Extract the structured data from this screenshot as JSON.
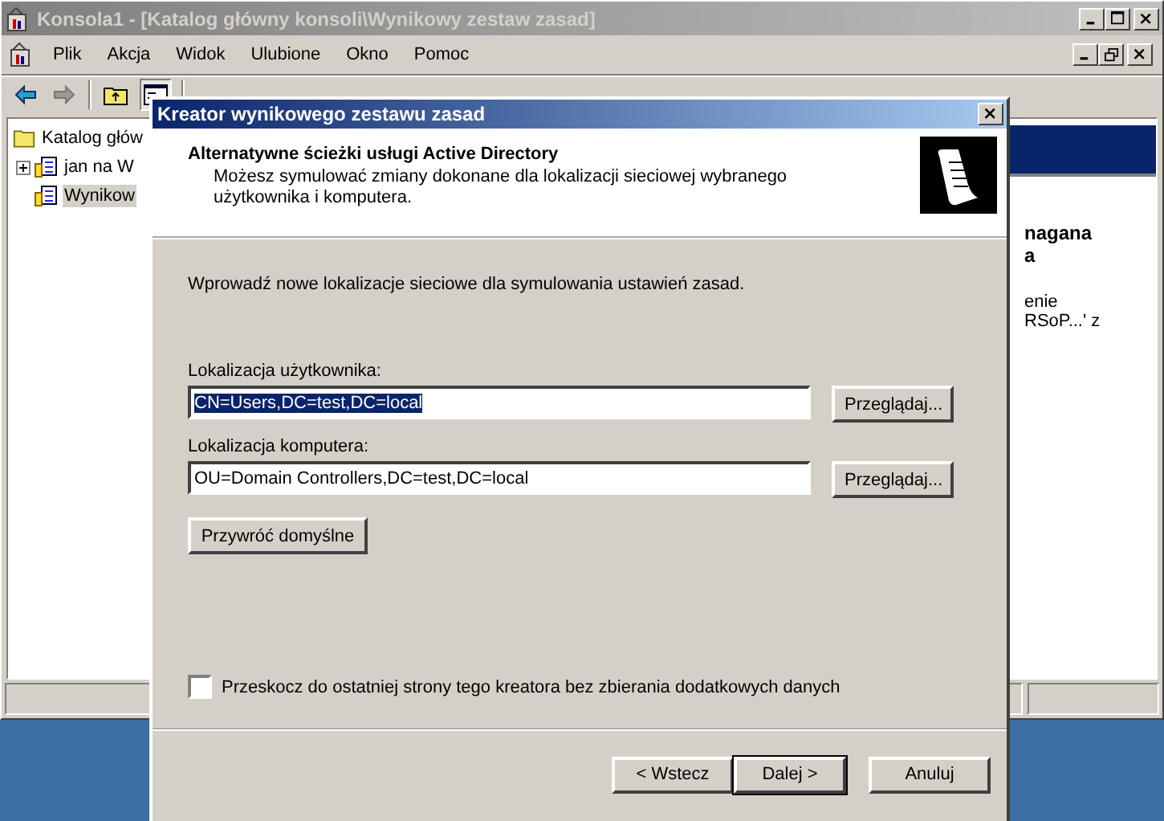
{
  "window": {
    "title": "Konsola1 - [Katalog główny konsoli\\Wynikowy zestaw zasad]",
    "active": false
  },
  "menu": [
    "Plik",
    "Akcja",
    "Widok",
    "Ulubione",
    "Okno",
    "Pomoc"
  ],
  "tree": [
    {
      "label": "Katalog głów",
      "selected": false,
      "children": [
        {
          "label": "jan na W",
          "selected": false,
          "expanded": false
        },
        {
          "label": "Wynikow",
          "selected": true
        }
      ]
    }
  ],
  "right_pane": {
    "lines": [
      {
        "text": "nagana",
        "bold": true
      },
      {
        "text": "a",
        "bold": true
      },
      {
        "text": "enie",
        "bold": false
      },
      {
        "text": "RSoP...' z",
        "bold": false
      }
    ]
  },
  "dialog": {
    "title": "Kreator wynikowego zestawu zasad",
    "active": true,
    "heading": "Alternatywne ścieżki usługi Active Directory",
    "subheading": "Możesz symulować zmiany dokonane dla lokalizacji sieciowej wybranego użytkownika i komputera.",
    "intro": "Wprowadź nowe lokalizacje sieciowe dla symulowania ustawień zasad.",
    "fields": [
      {
        "label": "Lokalizacja użytkownika:",
        "value": "CN=Users,DC=test,DC=local",
        "text_selected": true,
        "browse": "Przeglądaj..."
      },
      {
        "label": "Lokalizacja komputera:",
        "value": "OU=Domain Controllers,DC=test,DC=local",
        "text_selected": false,
        "browse": "Przeglądaj..."
      }
    ],
    "restore_button": "Przywróć domyślne",
    "skip_checkbox": {
      "label": "Przeskocz do ostatniej strony tego kreatora bez zbierania dodatkowych danych",
      "checked": false
    },
    "buttons": [
      {
        "label": "< Wstecz",
        "default": false
      },
      {
        "label": "Dalej >",
        "default": true
      },
      {
        "label": "Anuluj",
        "default": false
      }
    ]
  }
}
